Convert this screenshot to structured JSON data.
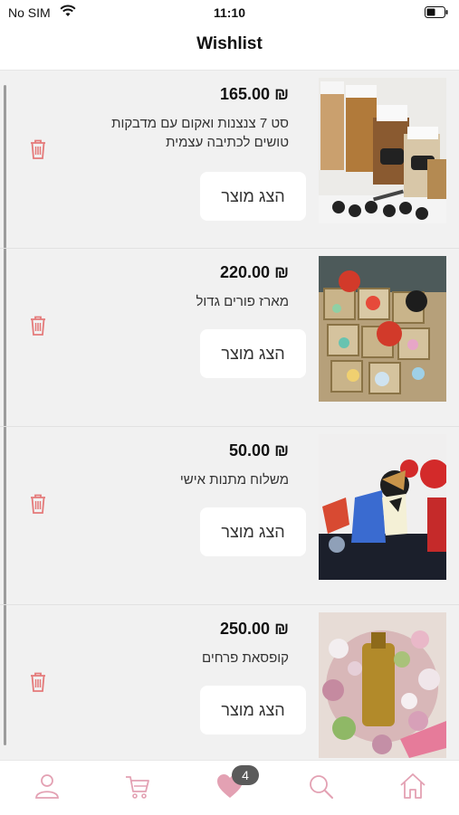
{
  "status_bar": {
    "carrier": "No SIM",
    "time": "11:10"
  },
  "header": {
    "title": "Wishlist"
  },
  "wishlist": {
    "items": [
      {
        "price": "₪ 165.00",
        "title": "סט 7 צנצנות ואקום עם מדבקות טושים לכתיבה עצמית",
        "button": "הצג מוצר"
      },
      {
        "price": "₪ 220.00",
        "title": "מארז פורים גדול",
        "button": "הצג מוצר"
      },
      {
        "price": "₪ 50.00",
        "title": "משלוח מתנות אישי",
        "button": "הצג מוצר"
      },
      {
        "price": "₪ 250.00",
        "title": "קופסאת פרחים",
        "button": "הצג מוצר"
      }
    ]
  },
  "tab_bar": {
    "tabs": [
      "user-icon",
      "cart-icon",
      "heart-icon",
      "search-icon",
      "home-icon"
    ],
    "active": "heart-icon",
    "wishlist_count": "4"
  },
  "colors": {
    "accent_pink": "#e3a1b3",
    "trash_red": "#e47a7a",
    "list_bg": "#f1f1f1"
  }
}
